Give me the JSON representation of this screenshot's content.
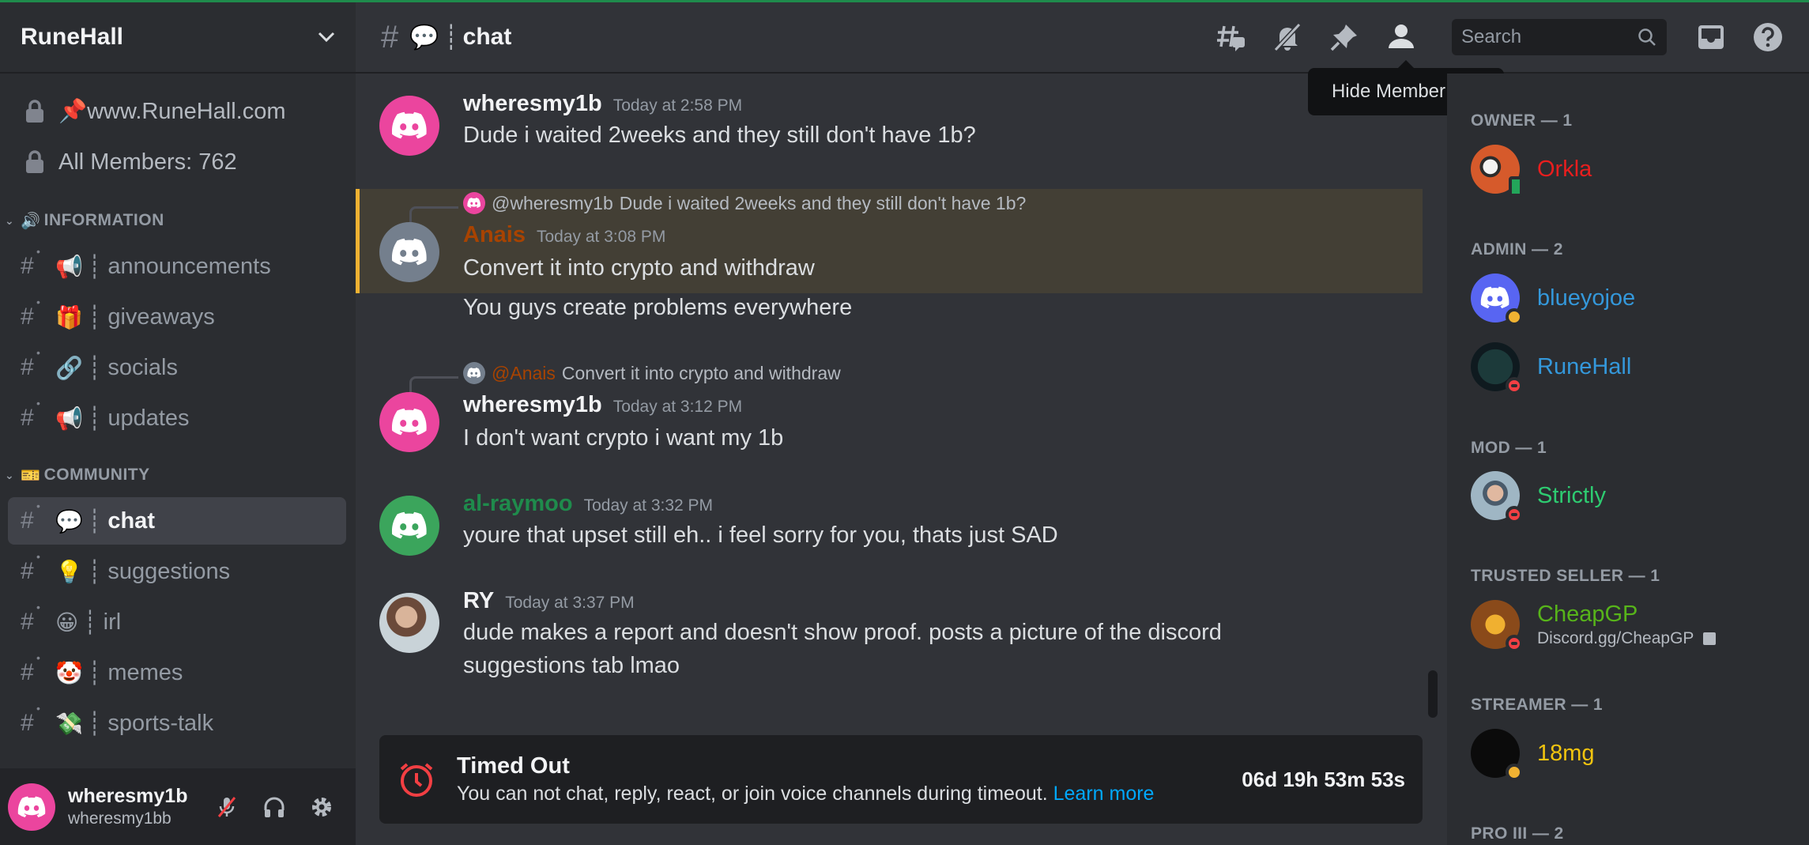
{
  "server": {
    "name": "RuneHall"
  },
  "sidebar": {
    "pinned": [
      {
        "label": "📌www.RuneHall.com"
      },
      {
        "label": "All Members: 762"
      }
    ],
    "categories": [
      {
        "emoji": "🔊",
        "label": "INFORMATION",
        "channels": [
          {
            "emoji": "📢",
            "name": "announcements"
          },
          {
            "emoji": "🎁",
            "name": "giveaways"
          },
          {
            "emoji": "🔗",
            "name": "socials"
          },
          {
            "emoji": "📢",
            "name": "updates"
          }
        ]
      },
      {
        "emoji": "🎫",
        "label": "COMMUNITY",
        "channels": [
          {
            "emoji": "💬",
            "name": "chat"
          },
          {
            "emoji": "💡",
            "name": "suggestions"
          },
          {
            "emoji": "😀",
            "name": "irl"
          },
          {
            "emoji": "🤡",
            "name": "memes"
          },
          {
            "emoji": "💸",
            "name": "sports-talk"
          }
        ]
      }
    ],
    "user": {
      "display_name": "wheresmy1b",
      "username": "wheresmy1bb"
    }
  },
  "header": {
    "emoji": "💬",
    "separator": "┊",
    "channel": "chat",
    "search_placeholder": "Search",
    "tooltip": "Hide Member List"
  },
  "messages": [
    {
      "author": "wheresmy1b",
      "time": "Today at 2:58 PM",
      "lines": [
        "Dude i waited 2weeks and they still don't have 1b?"
      ]
    },
    {
      "reply_to": "@wheresmy1b",
      "reply_text": "Dude i waited 2weeks and they still don't have 1b?",
      "author": "Anais",
      "time": "Today at 3:08 PM",
      "lines": [
        "Convert it into crypto and withdraw",
        "You guys create problems everywhere"
      ]
    },
    {
      "reply_to": "@Anais",
      "reply_text": "Convert it into crypto and withdraw",
      "author": "wheresmy1b",
      "time": "Today at 3:12 PM",
      "lines": [
        "I don't want crypto i want my 1b"
      ]
    },
    {
      "author": "al-raymoo",
      "time": "Today at 3:32 PM",
      "lines": [
        "youre that upset still eh.. i feel sorry for you, thats just SAD"
      ]
    },
    {
      "author": "RY",
      "time": "Today at 3:37 PM",
      "lines": [
        "dude makes a report and doesn't show proof. posts a picture of the discord",
        "suggestions tab lmao"
      ]
    }
  ],
  "timeout": {
    "title": "Timed Out",
    "description": "You can not chat, reply, react, or join voice channels during timeout.",
    "link": "Learn more",
    "countdown": "06d 19h 53m 53s"
  },
  "members": [
    {
      "category": "OWNER — 1",
      "users": [
        {
          "name": "Orkla",
          "color": "#e91e1e",
          "status": "mobile"
        }
      ]
    },
    {
      "category": "ADMIN — 2",
      "users": [
        {
          "name": "blueyojoe",
          "color": "#3498db",
          "status": "idle"
        },
        {
          "name": "RuneHall",
          "color": "#3498db",
          "status": "dnd"
        }
      ]
    },
    {
      "category": "MOD — 1",
      "users": [
        {
          "name": "Strictly",
          "color": "#2ecc71",
          "status": "dnd"
        }
      ]
    },
    {
      "category": "TRUSTED SELLER — 1",
      "users": [
        {
          "name": "CheapGP",
          "color": "#57b41a",
          "status": "dnd",
          "activity": "Discord.gg/CheapGP"
        }
      ]
    },
    {
      "category": "STREAMER — 1",
      "users": [
        {
          "name": "18mg",
          "color": "#f1c40f",
          "status": "idle"
        }
      ]
    },
    {
      "category": "PRO III — 2",
      "users": []
    }
  ],
  "colors": {
    "accent": "#5865f2",
    "link": "#00a8fc",
    "mention_highlight": "#f0b232",
    "anais": "#a84300",
    "al_raymoo": "#1f8b4c",
    "pink_avatar": "#eb459e",
    "green_avatar": "#3ba55c",
    "grey_avatar": "#747f8d"
  }
}
